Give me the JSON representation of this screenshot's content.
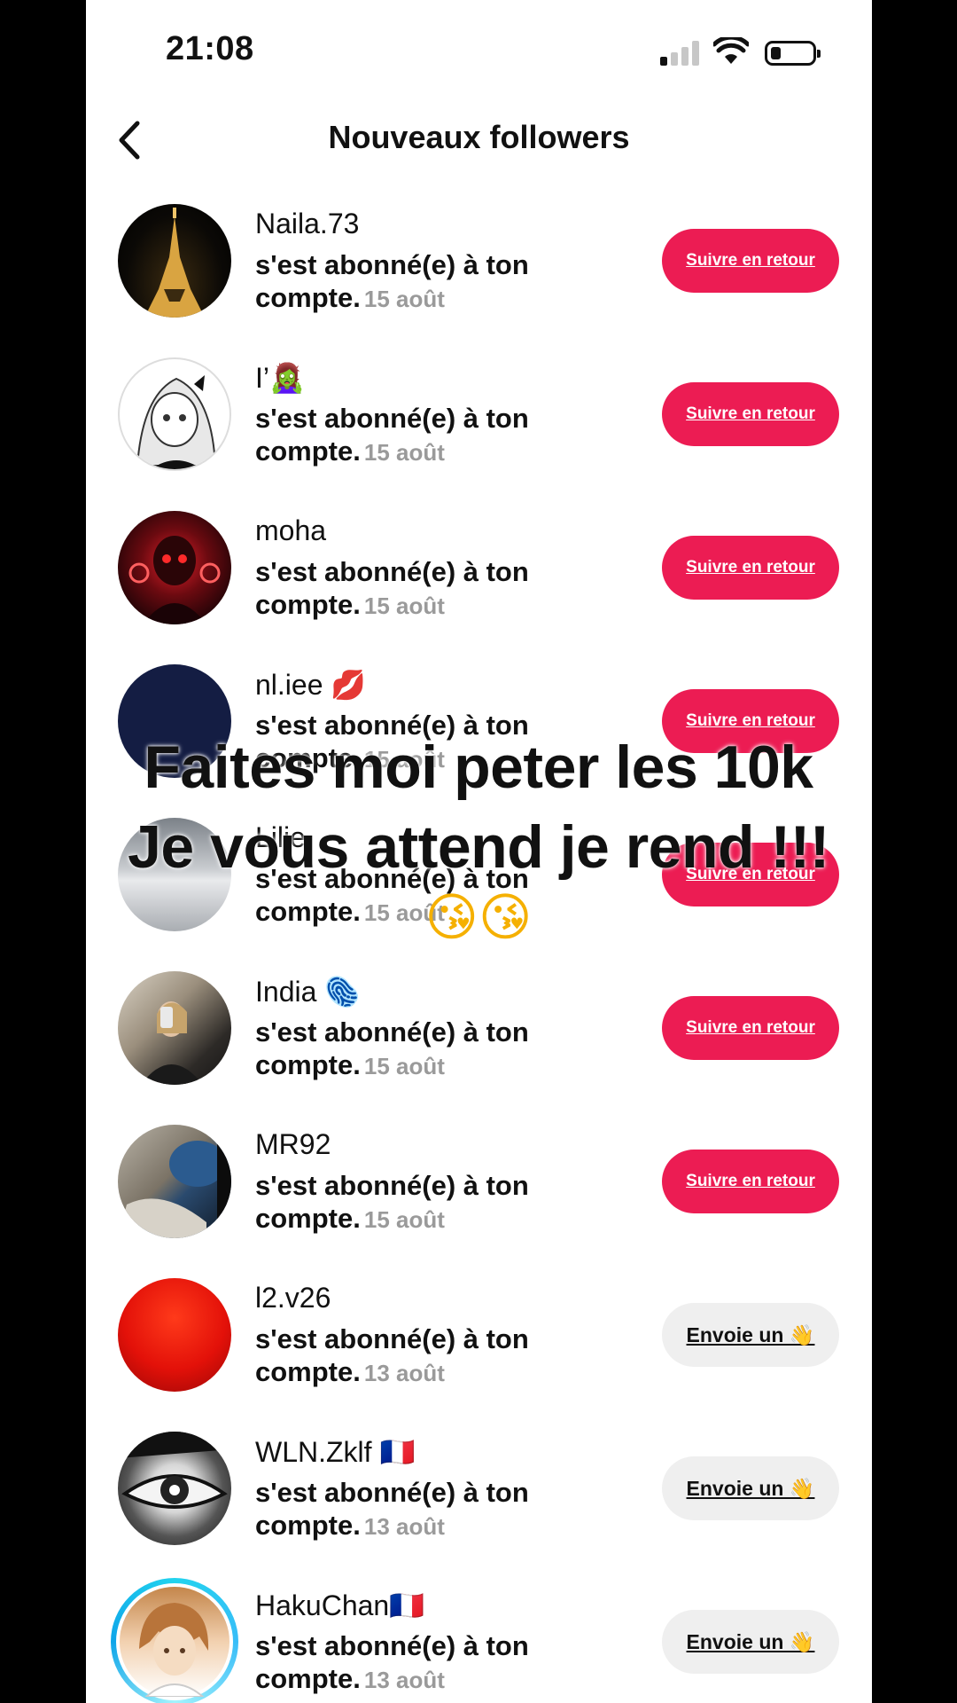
{
  "status_bar": {
    "time": "21:08"
  },
  "header": {
    "title": "Nouveaux followers"
  },
  "followers": [
    {
      "username": "Naila.73",
      "action": "s'est abonné(e) à ton compte.",
      "date": "15 août",
      "button": "Suivre en retour",
      "button_type": "follow"
    },
    {
      "username": "I’🧟‍♀️",
      "action": "s'est abonné(e) à ton compte.",
      "date": "15 août",
      "button": "Suivre en retour",
      "button_type": "follow"
    },
    {
      "username": "moha",
      "action": "s'est abonné(e) à ton compte.",
      "date": "15 août",
      "button": "Suivre en retour",
      "button_type": "follow"
    },
    {
      "username": "nl.iee 💋",
      "action": "s'est abonné(e) à ton compte.",
      "date": "15 août",
      "button": "Suivre en retour",
      "button_type": "follow"
    },
    {
      "username": "Lilie",
      "action": "s'est abonné(e) à ton compte.",
      "date": "15 août",
      "button": "Suivre en retour",
      "button_type": "follow"
    },
    {
      "username": "India 🫆",
      "action": "s'est abonné(e) à ton compte.",
      "date": "15 août",
      "button": "Suivre en retour",
      "button_type": "follow"
    },
    {
      "username": "MR92",
      "action": "s'est abonné(e) à ton compte.",
      "date": "15 août",
      "button": "Suivre en retour",
      "button_type": "follow"
    },
    {
      "username": "l2.v26",
      "action": "s'est abonné(e) à ton compte.",
      "date": "13 août",
      "button": "Envoie un 👋",
      "button_type": "wave"
    },
    {
      "username": "WLN.Zklf 🇫🇷",
      "action": "s'est abonné(e) à ton compte.",
      "date": "13 août",
      "button": "Envoie un 👋",
      "button_type": "wave"
    },
    {
      "username": "HakuChan🇫🇷",
      "action": "s'est abonné(e) à ton compte.",
      "date": "13 août",
      "button": "Envoie un 👋",
      "button_type": "wave"
    }
  ],
  "overlay": {
    "line1": "Faites moi peter les 10k",
    "line2": "Je vous attend je rend !!!",
    "emoji": "😘😘"
  },
  "colors": {
    "follow_button": "#ec1c53",
    "wave_button": "#efefef",
    "date_text": "#9a9a9a"
  }
}
